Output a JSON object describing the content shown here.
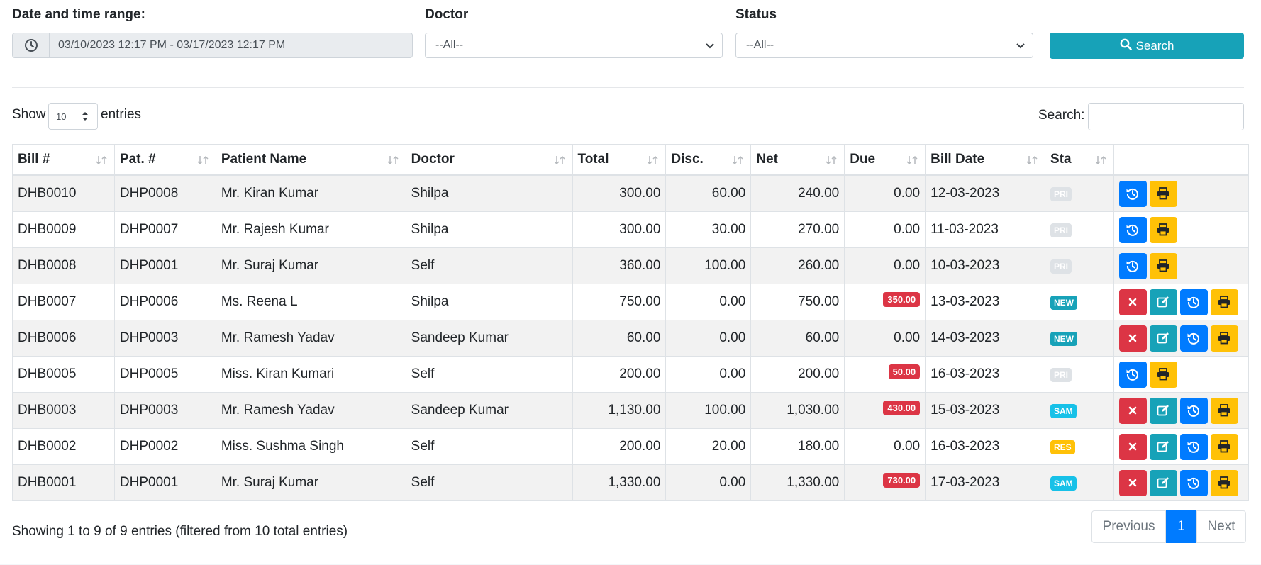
{
  "filters": {
    "date_label": "Date and time range:",
    "date_value": "03/10/2023 12:17 PM - 03/17/2023 12:17 PM",
    "doctor_label": "Doctor",
    "doctor_value": "--All--",
    "status_label": "Status",
    "status_value": "--All--",
    "search_button": "Search"
  },
  "table_controls": {
    "show_label": "Show",
    "entries_label": "entries",
    "page_length": "10",
    "search_label": "Search:"
  },
  "columns": [
    "Bill #",
    "Pat. #",
    "Patient Name",
    "Doctor",
    "Total",
    "Disc.",
    "Net",
    "Due",
    "Bill Date",
    "Sta",
    ""
  ],
  "rows": [
    {
      "bill": "DHB0010",
      "pat": "DHP0008",
      "name": "Mr. Kiran Kumar",
      "doctor": "Shilpa",
      "total": "300.00",
      "disc": "60.00",
      "net": "240.00",
      "due": "0.00",
      "due_flag": false,
      "date": "12-03-2023",
      "status": "PRI",
      "status_color": "#dee2e6",
      "actions": [
        "history",
        "print"
      ]
    },
    {
      "bill": "DHB0009",
      "pat": "DHP0007",
      "name": "Mr. Rajesh Kumar",
      "doctor": "Shilpa",
      "total": "300.00",
      "disc": "30.00",
      "net": "270.00",
      "due": "0.00",
      "due_flag": false,
      "date": "11-03-2023",
      "status": "PRI",
      "status_color": "#dee2e6",
      "actions": [
        "history",
        "print"
      ]
    },
    {
      "bill": "DHB0008",
      "pat": "DHP0001",
      "name": "Mr. Suraj Kumar",
      "doctor": "Self",
      "total": "360.00",
      "disc": "100.00",
      "net": "260.00",
      "due": "0.00",
      "due_flag": false,
      "date": "10-03-2023",
      "status": "PRI",
      "status_color": "#dee2e6",
      "actions": [
        "history",
        "print"
      ]
    },
    {
      "bill": "DHB0007",
      "pat": "DHP0006",
      "name": "Ms. Reena L",
      "doctor": "Shilpa",
      "total": "750.00",
      "disc": "0.00",
      "net": "750.00",
      "due": "350.00",
      "due_flag": true,
      "date": "13-03-2023",
      "status": "NEW",
      "status_color": "#17a2b8",
      "actions": [
        "delete",
        "edit",
        "history",
        "print"
      ]
    },
    {
      "bill": "DHB0006",
      "pat": "DHP0003",
      "name": "Mr. Ramesh Yadav",
      "doctor": "Sandeep Kumar",
      "total": "60.00",
      "disc": "0.00",
      "net": "60.00",
      "due": "0.00",
      "due_flag": false,
      "date": "14-03-2023",
      "status": "NEW",
      "status_color": "#17a2b8",
      "actions": [
        "delete",
        "edit",
        "history",
        "print"
      ]
    },
    {
      "bill": "DHB0005",
      "pat": "DHP0005",
      "name": "Miss. Kiran Kumari",
      "doctor": "Self",
      "total": "200.00",
      "disc": "0.00",
      "net": "200.00",
      "due": "50.00",
      "due_flag": true,
      "date": "16-03-2023",
      "status": "PRI",
      "status_color": "#dee2e6",
      "actions": [
        "history",
        "print"
      ]
    },
    {
      "bill": "DHB0003",
      "pat": "DHP0003",
      "name": "Mr. Ramesh Yadav",
      "doctor": "Sandeep Kumar",
      "total": "1,130.00",
      "disc": "100.00",
      "net": "1,030.00",
      "due": "430.00",
      "due_flag": true,
      "date": "15-03-2023",
      "status": "SAM",
      "status_color": "#17c1e8",
      "actions": [
        "delete",
        "edit",
        "history",
        "print"
      ]
    },
    {
      "bill": "DHB0002",
      "pat": "DHP0002",
      "name": "Miss. Sushma Singh",
      "doctor": "Self",
      "total": "200.00",
      "disc": "20.00",
      "net": "180.00",
      "due": "0.00",
      "due_flag": false,
      "date": "16-03-2023",
      "status": "RES",
      "status_color": "#ffc107",
      "actions": [
        "delete",
        "edit",
        "history",
        "print"
      ]
    },
    {
      "bill": "DHB0001",
      "pat": "DHP0001",
      "name": "Mr. Suraj Kumar",
      "doctor": "Self",
      "total": "1,330.00",
      "disc": "0.00",
      "net": "1,330.00",
      "due": "730.00",
      "due_flag": true,
      "date": "17-03-2023",
      "status": "SAM",
      "status_color": "#17c1e8",
      "actions": [
        "delete",
        "edit",
        "history",
        "print"
      ]
    }
  ],
  "footer": {
    "info": "Showing 1 to 9 of 9 entries (filtered from 10 total entries)",
    "previous": "Previous",
    "current_page": "1",
    "next": "Next"
  },
  "colors": {
    "primary": "#007bff",
    "info": "#17a2b8",
    "danger": "#dc3545",
    "warning": "#ffc107"
  }
}
